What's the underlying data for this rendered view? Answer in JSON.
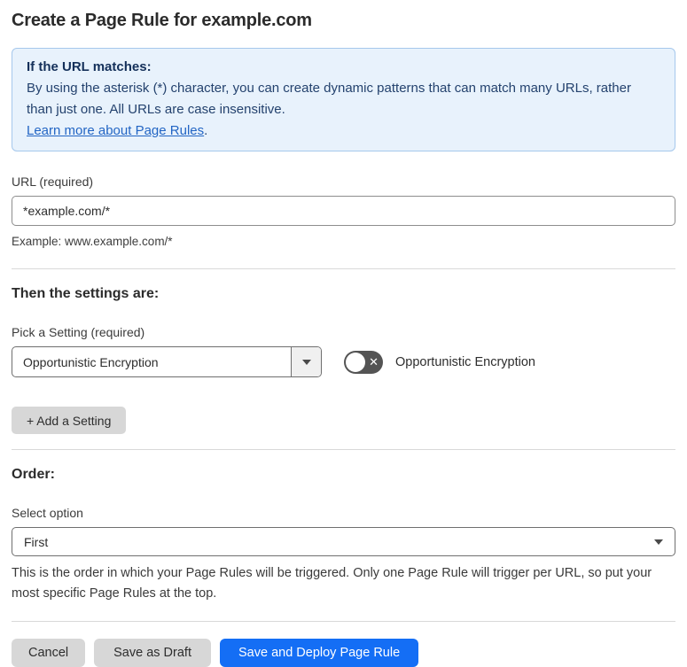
{
  "page": {
    "title": "Create a Page Rule for example.com"
  },
  "info_box": {
    "heading": "If the URL matches:",
    "body": "By using the asterisk (*) character, you can create dynamic patterns that can match many URLs, rather than just one. All URLs are case insensitive.",
    "link_label": "Learn more about Page Rules",
    "link_suffix": "."
  },
  "url_field": {
    "label": "URL (required)",
    "value": "*example.com/*",
    "help": "Example: www.example.com/*"
  },
  "settings_section": {
    "heading": "Then the settings are:",
    "picker_label": "Pick a Setting (required)",
    "picker_value": "Opportunistic Encryption",
    "toggle_state": "off",
    "toggle_label": "Opportunistic Encryption",
    "add_setting_label": "+ Add a Setting"
  },
  "order_section": {
    "heading": "Order:",
    "select_label": "Select option",
    "select_value": "First",
    "help": "This is the order in which your Page Rules will be triggered. Only one Page Rule will trigger per URL, so put your most specific Page Rules at the top."
  },
  "footer": {
    "cancel_label": "Cancel",
    "save_draft_label": "Save as Draft",
    "save_deploy_label": "Save and Deploy Page Rule"
  },
  "icons": {
    "dropdown_caret": "caret-down",
    "select_caret": "caret-down",
    "toggle_x_glyph": "✕"
  },
  "colors": {
    "accent_blue": "#146ef5",
    "info_bg": "#e8f2fc",
    "info_border": "#a6c8ec",
    "info_heading": "#14305a",
    "info_text": "#24426e",
    "link_blue": "#2265c4",
    "toggle_off_bg": "#545454",
    "button_gray": "#d7d7d7"
  }
}
